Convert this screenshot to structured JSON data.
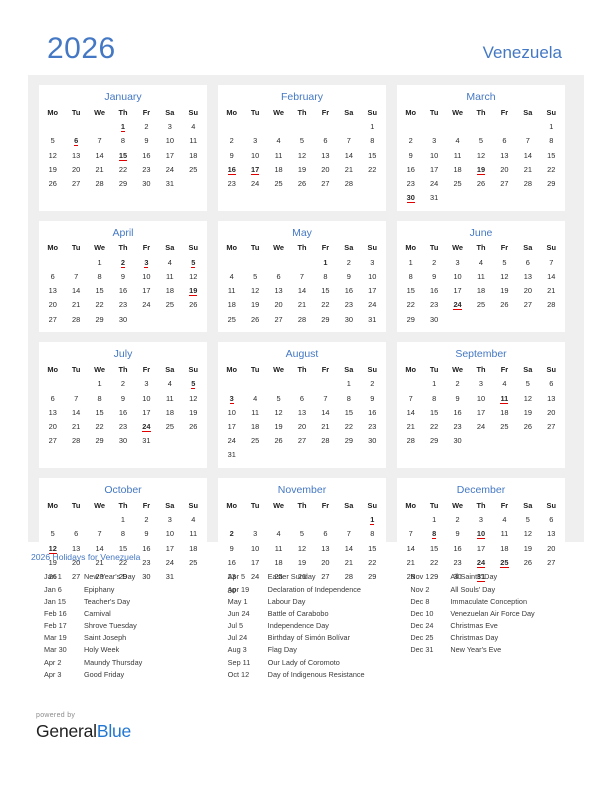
{
  "header": {
    "year": "2026",
    "country": "Venezuela"
  },
  "colors": {
    "accent_blue": "#4478c4",
    "holiday_red": "#e00000",
    "panel_gray": "#efeff0",
    "logo_blue": "#2176d2"
  },
  "weekday_headers": [
    "Mo",
    "Tu",
    "We",
    "Th",
    "Fr",
    "Sa",
    "Su"
  ],
  "months": [
    {
      "name": "January",
      "lead_blanks": 3,
      "days": 31,
      "holidays": [
        1,
        6,
        15
      ],
      "holidays_underlined": [
        1,
        6,
        15
      ]
    },
    {
      "name": "February",
      "lead_blanks": 6,
      "days": 28,
      "holidays": [
        16,
        17
      ],
      "holidays_underlined": [
        16,
        17
      ]
    },
    {
      "name": "March",
      "lead_blanks": 6,
      "days": 31,
      "holidays": [
        19,
        30
      ],
      "holidays_underlined": [
        19,
        30
      ]
    },
    {
      "name": "April",
      "lead_blanks": 2,
      "days": 30,
      "holidays": [
        2,
        3,
        5,
        19
      ],
      "holidays_underlined": [
        2,
        3,
        5,
        19
      ]
    },
    {
      "name": "May",
      "lead_blanks": 4,
      "days": 31,
      "holidays": [
        1
      ],
      "holidays_underlined": []
    },
    {
      "name": "June",
      "lead_blanks": 0,
      "days": 30,
      "holidays": [
        24
      ],
      "holidays_underlined": [
        24
      ]
    },
    {
      "name": "July",
      "lead_blanks": 2,
      "days": 31,
      "holidays": [
        5,
        24
      ],
      "holidays_underlined": [
        5,
        24
      ]
    },
    {
      "name": "August",
      "lead_blanks": 5,
      "days": 31,
      "holidays": [
        3
      ],
      "holidays_underlined": [
        3
      ]
    },
    {
      "name": "September",
      "lead_blanks": 1,
      "days": 30,
      "holidays": [
        11
      ],
      "holidays_underlined": [
        11
      ]
    },
    {
      "name": "October",
      "lead_blanks": 3,
      "days": 31,
      "holidays": [
        12
      ],
      "holidays_underlined": [
        12
      ]
    },
    {
      "name": "November",
      "lead_blanks": 6,
      "days": 30,
      "holidays": [
        1,
        2
      ],
      "holidays_underlined": [
        1
      ]
    },
    {
      "name": "December",
      "lead_blanks": 1,
      "days": 31,
      "holidays": [
        8,
        10,
        24,
        25,
        31
      ],
      "holidays_underlined": [
        8,
        10,
        24,
        25,
        31
      ]
    }
  ],
  "holidays_section": {
    "title": "2026 Holidays for Venezuela",
    "columns": [
      [
        {
          "date": "Jan 1",
          "name": "New Year's Day"
        },
        {
          "date": "Jan 6",
          "name": "Epiphany"
        },
        {
          "date": "Jan 15",
          "name": "Teacher's Day"
        },
        {
          "date": "Feb 16",
          "name": "Carnival"
        },
        {
          "date": "Feb 17",
          "name": "Shrove Tuesday"
        },
        {
          "date": "Mar 19",
          "name": "Saint Joseph"
        },
        {
          "date": "Mar 30",
          "name": "Holy Week"
        },
        {
          "date": "Apr 2",
          "name": "Maundy Thursday"
        },
        {
          "date": "Apr 3",
          "name": "Good Friday"
        }
      ],
      [
        {
          "date": "Apr 5",
          "name": "Easter Sunday"
        },
        {
          "date": "Apr 19",
          "name": "Declaration of Independence"
        },
        {
          "date": "May 1",
          "name": "Labour Day"
        },
        {
          "date": "Jun 24",
          "name": "Battle of Carabobo"
        },
        {
          "date": "Jul 5",
          "name": "Independence Day"
        },
        {
          "date": "Jul 24",
          "name": "Birthday of Simón Bolívar"
        },
        {
          "date": "Aug 3",
          "name": "Flag Day"
        },
        {
          "date": "Sep 11",
          "name": "Our Lady of Coromoto"
        },
        {
          "date": "Oct 12",
          "name": "Day of Indigenous Resistance"
        }
      ],
      [
        {
          "date": "Nov 1",
          "name": "All Saints' Day"
        },
        {
          "date": "Nov 2",
          "name": "All Souls' Day"
        },
        {
          "date": "Dec 8",
          "name": "Immaculate Conception"
        },
        {
          "date": "Dec 10",
          "name": "Venezuelan Air Force Day"
        },
        {
          "date": "Dec 24",
          "name": "Christmas Eve"
        },
        {
          "date": "Dec 25",
          "name": "Christmas Day"
        },
        {
          "date": "Dec 31",
          "name": "New Year's Eve"
        }
      ]
    ]
  },
  "footer": {
    "powered_by": "powered by",
    "logo_part1": "General",
    "logo_part2": "Blue"
  }
}
